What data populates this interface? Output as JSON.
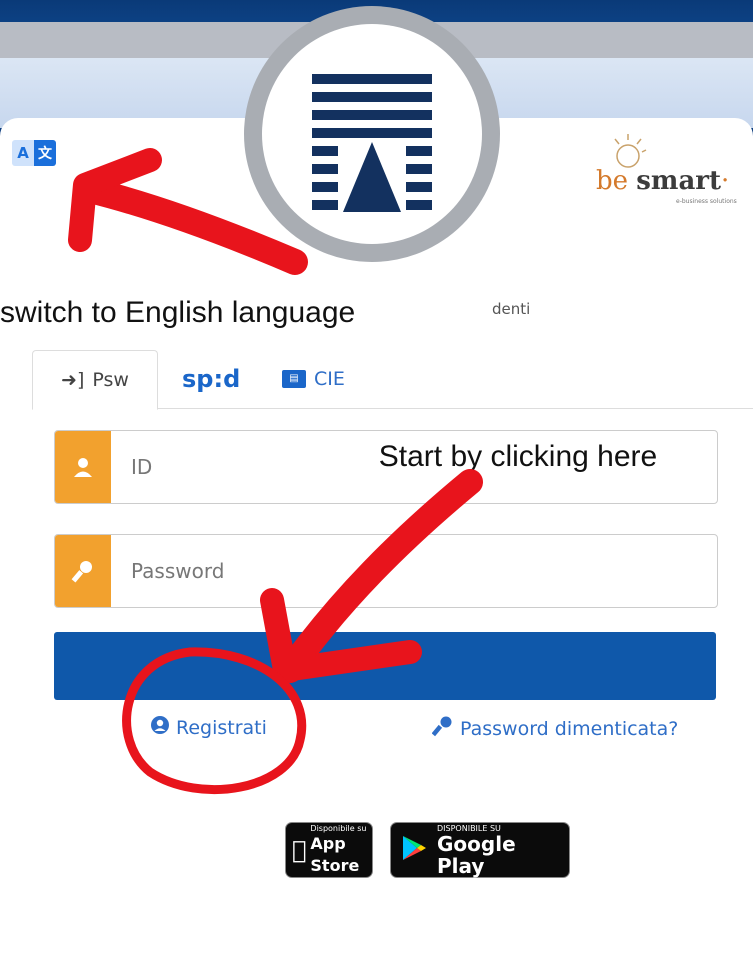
{
  "header": {
    "lang_toggle": {
      "left_glyph": "A",
      "right_glyph": "文"
    },
    "partner_logo": {
      "main": "be smart",
      "prefix": "be",
      "suffix": "smart",
      "trademark": "·",
      "tagline": "e-business solutions"
    }
  },
  "annotations": {
    "switch_caption": "switch to English language",
    "start_caption": "Start by clicking here",
    "arrow_color": "#e8141c"
  },
  "portal": {
    "subtitle_fragment": "denti"
  },
  "tabs": [
    {
      "id": "psw",
      "label": "Psw",
      "icon": "sign-in-icon",
      "active": true
    },
    {
      "id": "spid",
      "label": "sp:d",
      "icon": "spid-logo",
      "active": false
    },
    {
      "id": "cie",
      "label": "CIE",
      "icon": "id-card-icon",
      "active": false
    }
  ],
  "login_form": {
    "id_placeholder": "ID",
    "password_placeholder": "Password",
    "submit_label": ""
  },
  "links": {
    "register": "Registrati",
    "forgot_password": "Password dimenticata?"
  },
  "stores": {
    "app_store": {
      "small": "Disponibile su",
      "big": "App Store"
    },
    "google_play": {
      "small": "DISPONIBILE SU",
      "big": "Google Play"
    }
  },
  "colors": {
    "accent_orange": "#f2a12e",
    "primary_blue": "#0f58aa",
    "link_blue": "#2f6ec7"
  }
}
